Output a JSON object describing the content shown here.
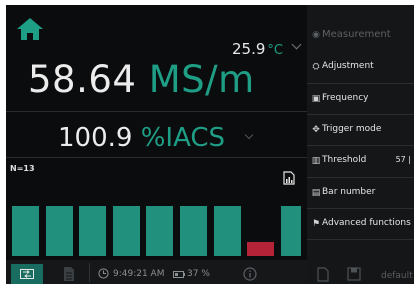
{
  "display": {
    "temperature": "25.9",
    "temperature_unit": "°C",
    "main_value": "58.64",
    "main_unit": "MS/m",
    "secondary_value": "100.9",
    "secondary_unit": "%IACS",
    "count_label": "N=13"
  },
  "histogram": {
    "values": [
      1,
      1,
      1,
      1,
      1,
      1,
      1,
      0.27,
      1
    ],
    "colors": [
      "#21907c",
      "#b52339"
    ]
  },
  "footer": {
    "time": "9:49:21 AM",
    "battery": "37 %"
  },
  "menu": {
    "items": [
      {
        "label": "Measurement",
        "icon": "radio-dot-icon"
      },
      {
        "label": "Adjustment",
        "icon": "adjustment-icon"
      },
      {
        "label": "Frequency",
        "icon": "frequency-icon"
      },
      {
        "label": "Trigger mode",
        "icon": "trigger-icon"
      },
      {
        "label": "Threshold",
        "icon": "threshold-icon",
        "value": "57 |"
      },
      {
        "label": "Bar number",
        "icon": "bar-number-icon"
      },
      {
        "label": "Advanced functions",
        "icon": "advanced-icon"
      }
    ],
    "default_label": "default"
  }
}
